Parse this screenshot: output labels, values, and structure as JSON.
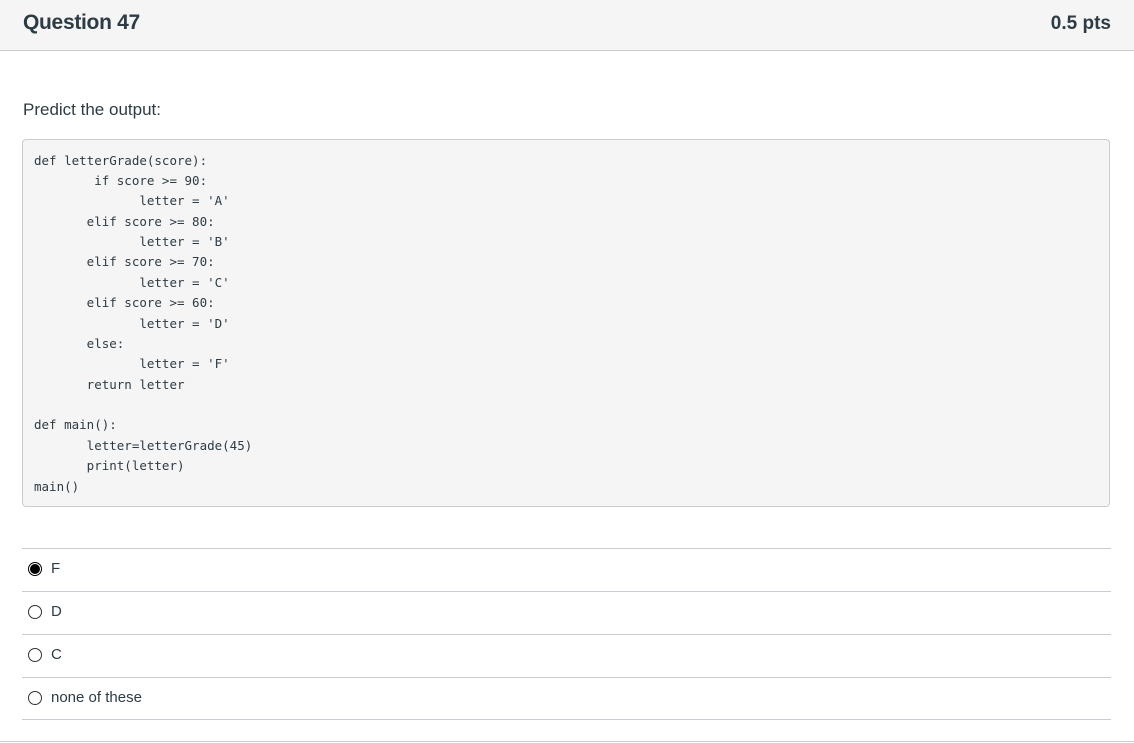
{
  "question": {
    "title": "Question 47",
    "points": "0.5 pts",
    "prompt": "Predict the output:"
  },
  "code": [
    "def letterGrade(score):",
    "        if score >= 90:",
    "              letter = 'A'",
    "       elif score >= 80:",
    "              letter = 'B'",
    "       elif score >= 70:",
    "              letter = 'C'",
    "       elif score >= 60:",
    "              letter = 'D'",
    "       else:",
    "              letter = 'F'",
    "       return letter",
    "",
    "def main():",
    "       letter=letterGrade(45)",
    "       print(letter)",
    "main()"
  ],
  "answers": [
    {
      "label": "F",
      "selected": true
    },
    {
      "label": "D",
      "selected": false
    },
    {
      "label": "C",
      "selected": false
    },
    {
      "label": "none of these",
      "selected": false
    }
  ]
}
